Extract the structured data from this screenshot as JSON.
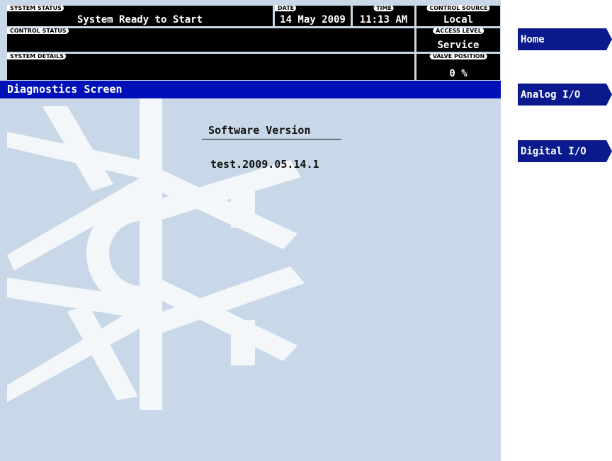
{
  "status_bar": {
    "system_status": {
      "label": "SYSTEM STATUS",
      "value": "System Ready to Start"
    },
    "date": {
      "label": "DATE",
      "value": "14 May 2009"
    },
    "time": {
      "label": "TIME",
      "value": "11:13 AM"
    },
    "control_source": {
      "label": "CONTROL SOURCE",
      "value": "Local"
    },
    "control_status": {
      "label": "CONTROL STATUS",
      "value": ""
    },
    "access_level": {
      "label": "ACCESS LEVEL",
      "value": "Service"
    },
    "system_details": {
      "label": "SYSTEM DETAILS",
      "value": ""
    },
    "valve_position": {
      "label": "VALVE POSITION",
      "value": "0 %"
    }
  },
  "screen_title": "Diagnostics Screen",
  "software": {
    "heading": "Software Version",
    "version": "test.2009.05.14.1"
  },
  "nav": {
    "home": "Home",
    "analog_io": "Analog I/O",
    "digital_io": "Digital I/O"
  },
  "colors": {
    "background": "#c8d8e8",
    "title_bar": "#0010b8",
    "nav_button": "#0a1a8c",
    "status_field": "#000000",
    "watermark": "#f4f7fa"
  },
  "icons": {
    "watermark": "snowflake-icon"
  }
}
